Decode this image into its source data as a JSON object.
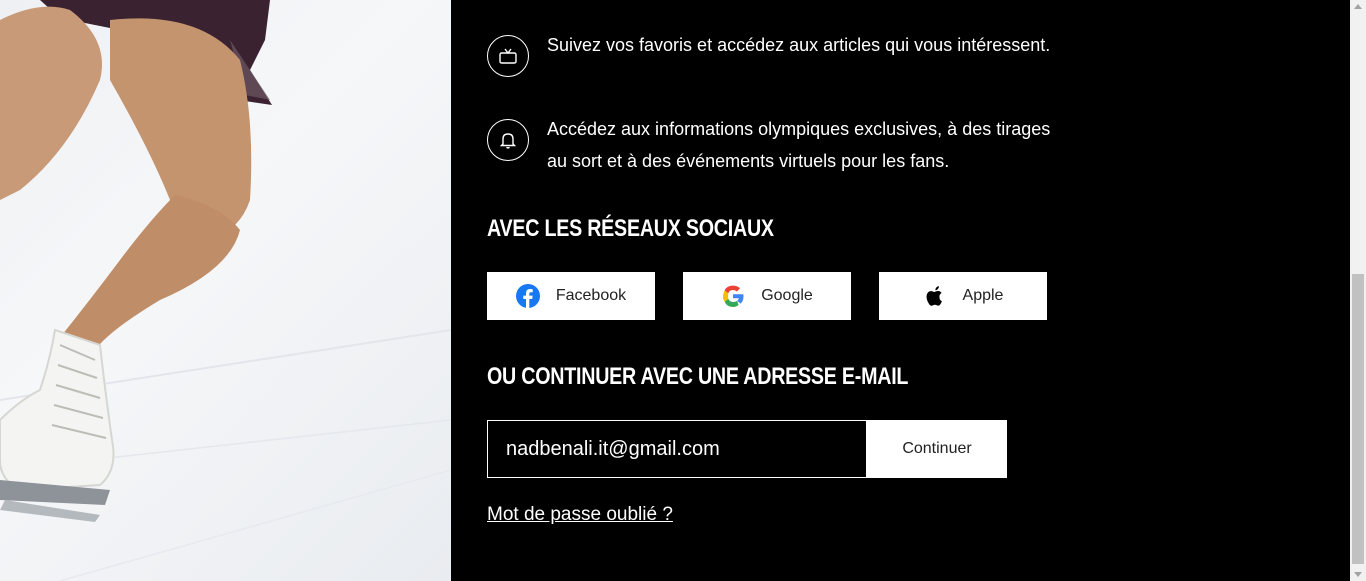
{
  "benefits": [
    {
      "icon": "tv-icon",
      "text": "Suivez vos favoris et accédez aux articles qui vous intéressent."
    },
    {
      "icon": "bell-icon",
      "text": "Accédez aux informations olympiques exclusives, à des tirages au sort et à des événements virtuels pour les fans."
    }
  ],
  "social": {
    "heading": "AVEC LES RÉSEAUX SOCIAUX",
    "buttons": [
      {
        "icon": "facebook-icon",
        "label": "Facebook"
      },
      {
        "icon": "google-icon",
        "label": "Google"
      },
      {
        "icon": "apple-icon",
        "label": "Apple"
      }
    ]
  },
  "email": {
    "heading": "OU CONTINUER AVEC UNE ADRESSE E-MAIL",
    "value": "nadbenali.it@gmail.com",
    "continue_label": "Continuer"
  },
  "forgot_password": "Mot de passe oublié ?",
  "colors": {
    "panel_bg": "#000000",
    "button_bg": "#ffffff",
    "facebook_blue": "#1877F2"
  }
}
